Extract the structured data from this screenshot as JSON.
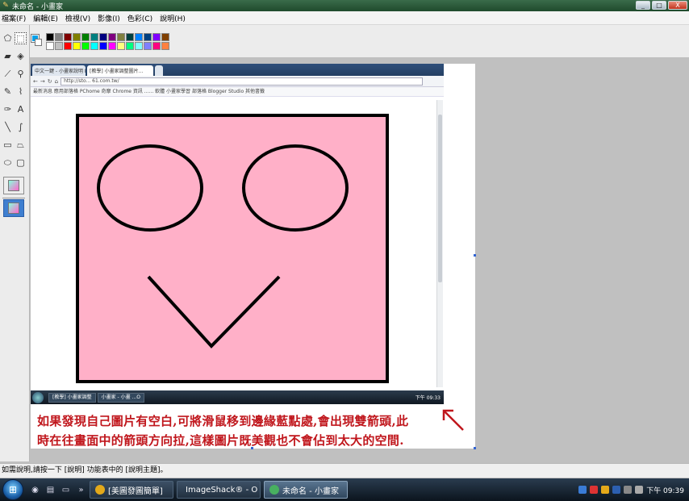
{
  "window": {
    "title": "未命名 - 小畫家",
    "buttons": [
      "_",
      "□",
      "X"
    ]
  },
  "menu": [
    "檔案(F)",
    "編輯(E)",
    "檢視(V)",
    "影像(I)",
    "色彩(C)",
    "說明(H)"
  ],
  "tools": [
    {
      "name": "free-select-icon",
      "glyph": "⬠"
    },
    {
      "name": "rect-select-icon",
      "glyph": "⬚",
      "active": true
    },
    {
      "name": "eraser-icon",
      "glyph": "▰"
    },
    {
      "name": "fill-bucket-icon",
      "glyph": "◈"
    },
    {
      "name": "eyedropper-icon",
      "glyph": "⟋"
    },
    {
      "name": "magnifier-icon",
      "glyph": "⚲"
    },
    {
      "name": "pencil-icon",
      "glyph": "✎"
    },
    {
      "name": "brush-icon",
      "glyph": "⌇"
    },
    {
      "name": "airbrush-icon",
      "glyph": "✑"
    },
    {
      "name": "text-icon",
      "glyph": "A"
    },
    {
      "name": "line-icon",
      "glyph": "╲"
    },
    {
      "name": "curve-icon",
      "glyph": "∫"
    },
    {
      "name": "rectangle-icon",
      "glyph": "▭"
    },
    {
      "name": "polygon-icon",
      "glyph": "⏢"
    },
    {
      "name": "ellipse-icon",
      "glyph": "⬭"
    },
    {
      "name": "rounded-rect-icon",
      "glyph": "▢"
    }
  ],
  "palette": {
    "foreground": "#00a0e9",
    "background": "#ffffff",
    "colors": [
      "#000000",
      "#808080",
      "#800000",
      "#808000",
      "#008000",
      "#008080",
      "#000080",
      "#800080",
      "#808040",
      "#004040",
      "#0080ff",
      "#004080",
      "#8000ff",
      "#804000",
      "#ffffff",
      "#c0c0c0",
      "#ff0000",
      "#ffff00",
      "#00ff00",
      "#00ffff",
      "#0000ff",
      "#ff00ff",
      "#ffff80",
      "#00ff80",
      "#80ffff",
      "#8080ff",
      "#ff0080",
      "#ff8040"
    ]
  },
  "browser": {
    "tabs": [
      "中文一鍵 - 小畫家說明 PL...",
      "[教學] 小畫家調整圖片...",
      ""
    ],
    "url": "http://sto... 61.com.tw/",
    "bookmarks": "最新消息  應用部落格  PChome  奇摩  Chrome 資訊  ......  軟體  小畫家學習  部落格  Blogger Studio  其他書籤",
    "taskbar_items": [
      "[教學] 小畫家調整",
      "小畫家 - 小畫 ...O"
    ],
    "tray": "下午 09:33"
  },
  "drawing": {
    "face_fill": "#ffb0c8",
    "stroke": "#000000"
  },
  "hint_lines": [
    "如果發現自己圖片有空白,可將滑鼠移到邊緣藍點處,會出現雙箭頭,此",
    "時在往畫面中的箭頭方向拉,這樣圖片既美觀也不會佔到太大的空間."
  ],
  "statusbar": {
    "text": "如需說明,請按一下 [說明] 功能表中的 [說明主題]。"
  },
  "taskbar": {
    "start_label": "⊞",
    "buttons": [
      {
        "label": "[美圖發圖簡單]",
        "active": false,
        "color": "#e4a91a"
      },
      {
        "label": "ImageShack® - O",
        "active": false,
        "color": "#e25d2b"
      },
      {
        "label": "未命名 - 小畫家",
        "active": true,
        "color": "#48b060"
      }
    ],
    "clock": "下午 09:39"
  }
}
